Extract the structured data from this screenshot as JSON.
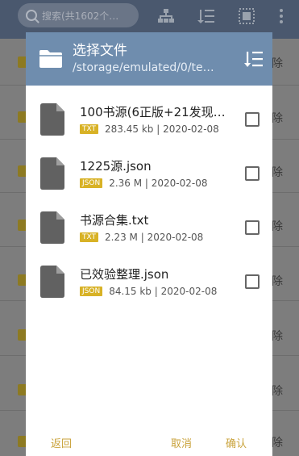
{
  "background": {
    "search_placeholder": "搜索(共1602个…",
    "delete_label": "除"
  },
  "dialog": {
    "title": "选择文件",
    "path": "/storage/emulated/0/te…",
    "files": [
      {
        "name": "100书源(6正版+21发现…",
        "type": "TXT",
        "size": "283.45 kb",
        "date": "2020-02-08",
        "checked": false
      },
      {
        "name": "1225源.json",
        "type": "JSON",
        "size": "2.36 M",
        "date": "2020-02-08",
        "checked": false
      },
      {
        "name": "书源合集.txt",
        "type": "TXT",
        "size": "2.23 M",
        "date": "2020-02-08",
        "checked": false
      },
      {
        "name": "已效验整理.json",
        "type": "JSON",
        "size": "84.15 kb",
        "date": "2020-02-08",
        "checked": false
      }
    ],
    "buttons": {
      "back": "返回",
      "cancel": "取消",
      "confirm": "确认"
    },
    "meta_separator": " | "
  },
  "colors": {
    "header": "#6f8dae",
    "badge": "#d8b226",
    "button_text": "#c9a23a"
  }
}
